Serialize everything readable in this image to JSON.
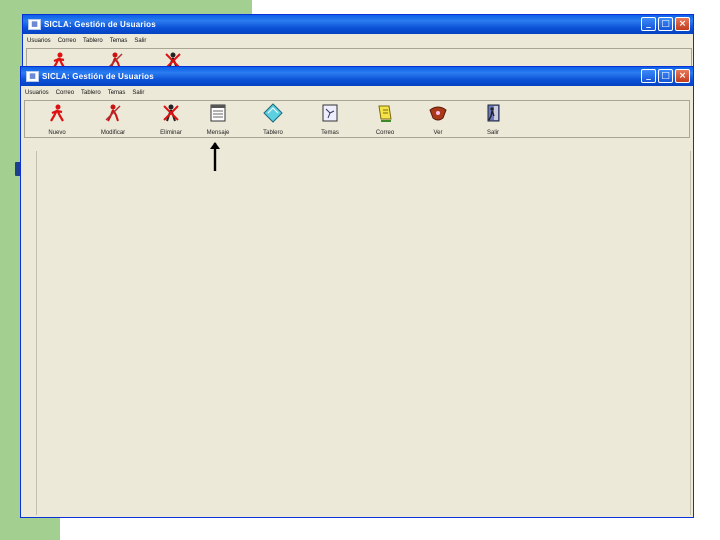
{
  "window": {
    "title": "SICLA: Gestión de Usuarios",
    "app_icon": "app-icon",
    "caption_buttons": {
      "minimize": "_",
      "maximize": "□",
      "close": "×"
    }
  },
  "menu": [
    "Usuarios",
    "Correo",
    "Tablero",
    "Temas",
    "Salir"
  ],
  "toolbar": {
    "items": [
      {
        "label": "Nuevo",
        "icon": "new-user-icon"
      },
      {
        "label": "Modificar",
        "icon": "modify-user-icon"
      },
      {
        "label": "Eliminar",
        "icon": "delete-user-icon"
      },
      {
        "label": "Mensaje",
        "icon": "message-icon"
      },
      {
        "label": "Tablero",
        "icon": "board-icon"
      },
      {
        "label": "Temas",
        "icon": "topics-icon"
      },
      {
        "label": "Correo",
        "icon": "mail-icon"
      },
      {
        "label": "Ver",
        "icon": "view-icon"
      },
      {
        "label": "Salir",
        "icon": "exit-icon"
      }
    ]
  },
  "colors": {
    "slide_green": "#a3cf91",
    "title_blue": "#0a50d5",
    "window_face": "#ece9d8"
  }
}
